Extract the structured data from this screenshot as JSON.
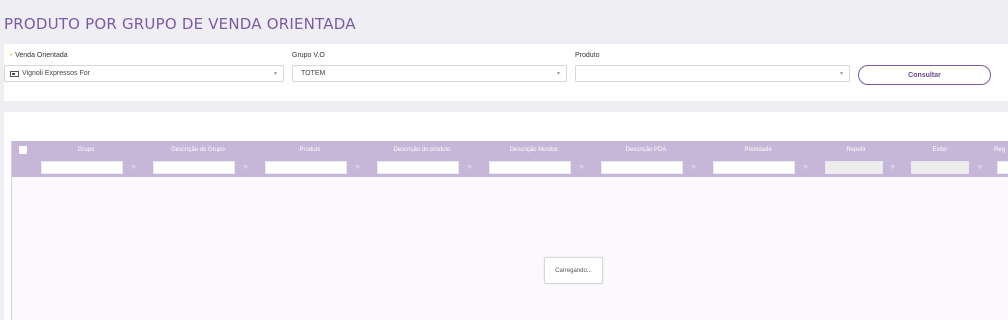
{
  "page": {
    "title": "PRODUTO POR GRUPO DE VENDA ORIENTADA"
  },
  "filters": {
    "venda_orientada": {
      "label": "Venda Orientada",
      "required_marker": "•",
      "value": "Vignoli Expressos For",
      "icon": "id-card-icon"
    },
    "grupo_vo": {
      "label": "Grupo V.O",
      "value": "TOTEM"
    },
    "produto": {
      "label": "Produto",
      "value": ""
    },
    "consultar_label": "Consultar",
    "chevron": "▾"
  },
  "grid": {
    "columns": [
      "Grupo",
      "Descrição do Grupo",
      "Produto",
      "Descrição do produto",
      "Descrição Monitor",
      "Descrição PDA",
      "Prioridade",
      "Repetir",
      "Exibir",
      "Reg"
    ],
    "filter_icon": "▿",
    "loading_text": "Carregando..."
  },
  "colors": {
    "accent": "#7b5aa6",
    "grid_header": "#c6b6d8",
    "required": "#f0a020"
  }
}
